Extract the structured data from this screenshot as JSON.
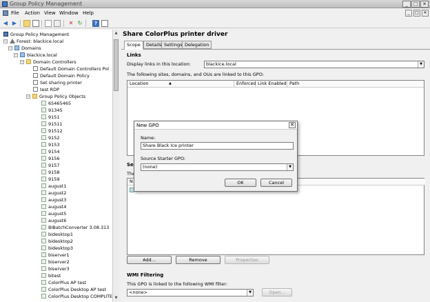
{
  "window": {
    "title": "Group Policy Management",
    "btn_min": "_",
    "btn_max": "□",
    "btn_close": "✕"
  },
  "menu": {
    "file": "File",
    "action": "Action",
    "view": "View",
    "window": "Window",
    "help": "Help"
  },
  "tree": {
    "root": "Group Policy Management",
    "forest": "Forest: blackice.local",
    "domains": "Domains",
    "domain": "blackice.local",
    "domain_controllers": "Domain Controllers",
    "default_dc_policy": "Default Domain Controllers Pol",
    "default_domain_policy": "Default Domain Policy",
    "set_sharing_printer": "Set sharing printer",
    "test_rdp": "test RDP",
    "gpo_folder": "Group Policy Objects",
    "gpos": [
      "65465465",
      "91345",
      "9151",
      "91511",
      "91512",
      "9152",
      "9153",
      "9154",
      "9156",
      "9157",
      "9158",
      "9159",
      "august1",
      "august2",
      "august3",
      "august4",
      "august5",
      "august6",
      "BIBatchConverter 3.08.313",
      "bidesktop1",
      "bidesktop2",
      "bidesktop3",
      "biserver1",
      "biserver2",
      "biserver3",
      "bitest",
      "ColorPlus AP test",
      "ColorPlus Desktop AP test",
      "ColorPlus Desktop COMPUTER"
    ]
  },
  "right": {
    "gpo_title": "Share ColorPlus printer driver",
    "tabs": [
      "Scope",
      "Details",
      "Settings",
      "Delegation"
    ],
    "links_title": "Links",
    "display_links_label": "Display links in this location:",
    "display_links_value": "blackice.local",
    "linked_text": "The following sites, domains, and OUs are linked to this GPO:",
    "columns": [
      "Location",
      "Enforced",
      "Link Enabled",
      "Path"
    ],
    "sort_indicator": "▲",
    "security_partial": "Se",
    "the_partial": "The",
    "name_partial": "N",
    "add_label": "Add...",
    "remove_label": "Remove",
    "properties_label": "Properties",
    "wmi_title": "WMI Filtering",
    "wmi_text": "This GPO is linked to the following WMI filter:",
    "wmi_value": "<none>",
    "open_label": "Open..."
  },
  "dialog": {
    "title": "New GPO",
    "close": "✕",
    "name_label": "Name:",
    "name_value": "Share Black Ice printer",
    "starter_label": "Source Starter GPO:",
    "starter_value": "(none)",
    "ok_label": "OK",
    "cancel_label": "Cancel"
  }
}
